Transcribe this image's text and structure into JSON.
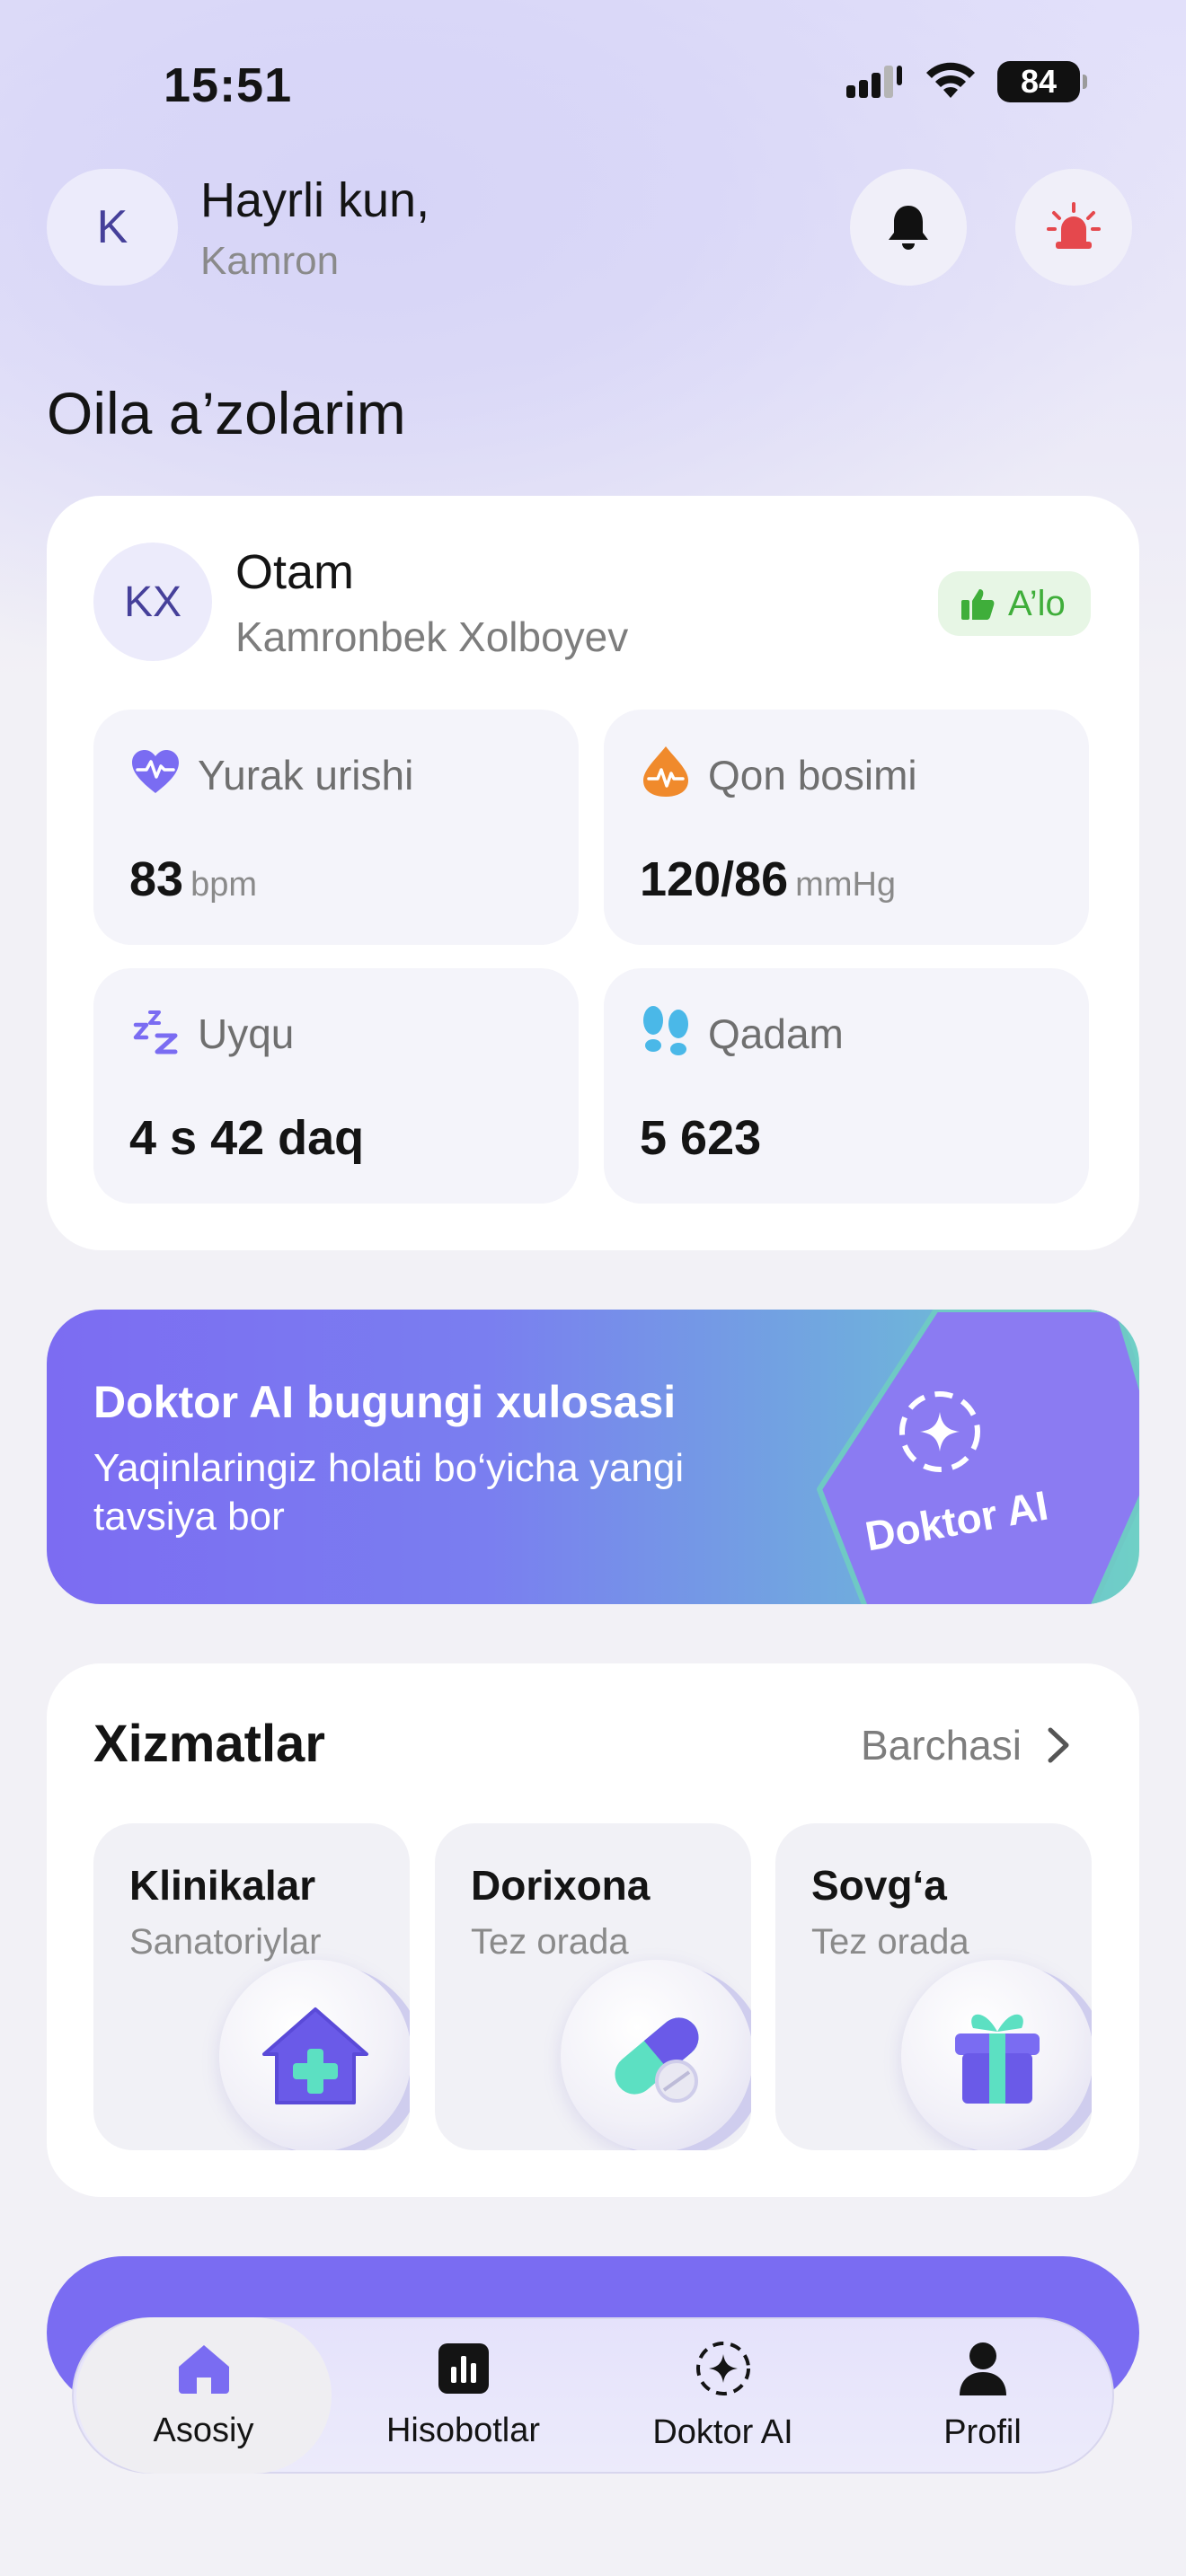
{
  "status_bar": {
    "time": "15:51",
    "battery": "84"
  },
  "header": {
    "avatar_initial": "K",
    "greeting": "Hayrli kun,",
    "user_name": "Kamron"
  },
  "family": {
    "section_title": "Oila a’zolarim",
    "member": {
      "initials": "KX",
      "role": "Otam",
      "full_name": "Kamronbek Xolboyev",
      "status": "A’lo"
    },
    "metrics": [
      {
        "label": "Yurak urishi",
        "value": "83",
        "unit": "bpm",
        "icon": "heart-pulse-icon",
        "color": "#7a6cf2"
      },
      {
        "label": "Qon bosimi",
        "value": "120/86",
        "unit": "mmHg",
        "icon": "blood-drop-icon",
        "color": "#f08a2c"
      },
      {
        "label": "Uyqu",
        "value": "4 s 42 daq",
        "unit": "",
        "icon": "sleep-zzz-icon",
        "color": "#7a6cf2"
      },
      {
        "label": "Qadam",
        "value": "5 623",
        "unit": "",
        "icon": "footsteps-icon",
        "color": "#4ab8e8"
      }
    ]
  },
  "ai_banner": {
    "title": "Doktor AI bugungi xulosasi",
    "subtitle": "Yaqinlaringiz holati bo‘yicha yangi tavsiya bor",
    "badge_label": "Doktor AI"
  },
  "services": {
    "title": "Xizmatlar",
    "all_label": "Barchasi",
    "items": [
      {
        "title": "Klinikalar",
        "subtitle": "Sanatoriylar",
        "icon": "clinic-house-icon"
      },
      {
        "title": "Dorixona",
        "subtitle": "Tez orada",
        "icon": "pill-icon"
      },
      {
        "title": "Sovg‘a",
        "subtitle": "Tez orada",
        "icon": "gift-icon"
      }
    ]
  },
  "tabbar": {
    "items": [
      {
        "label": "Asosiy",
        "icon": "home-icon",
        "active": true
      },
      {
        "label": "Hisobotlar",
        "icon": "chart-icon",
        "active": false
      },
      {
        "label": "Doktor AI",
        "icon": "ai-sparkle-icon",
        "active": false
      },
      {
        "label": "Profil",
        "icon": "person-icon",
        "active": false
      }
    ]
  },
  "colors": {
    "accent": "#7a6cf2",
    "success": "#3fae3a",
    "alert": "#e5484d"
  }
}
